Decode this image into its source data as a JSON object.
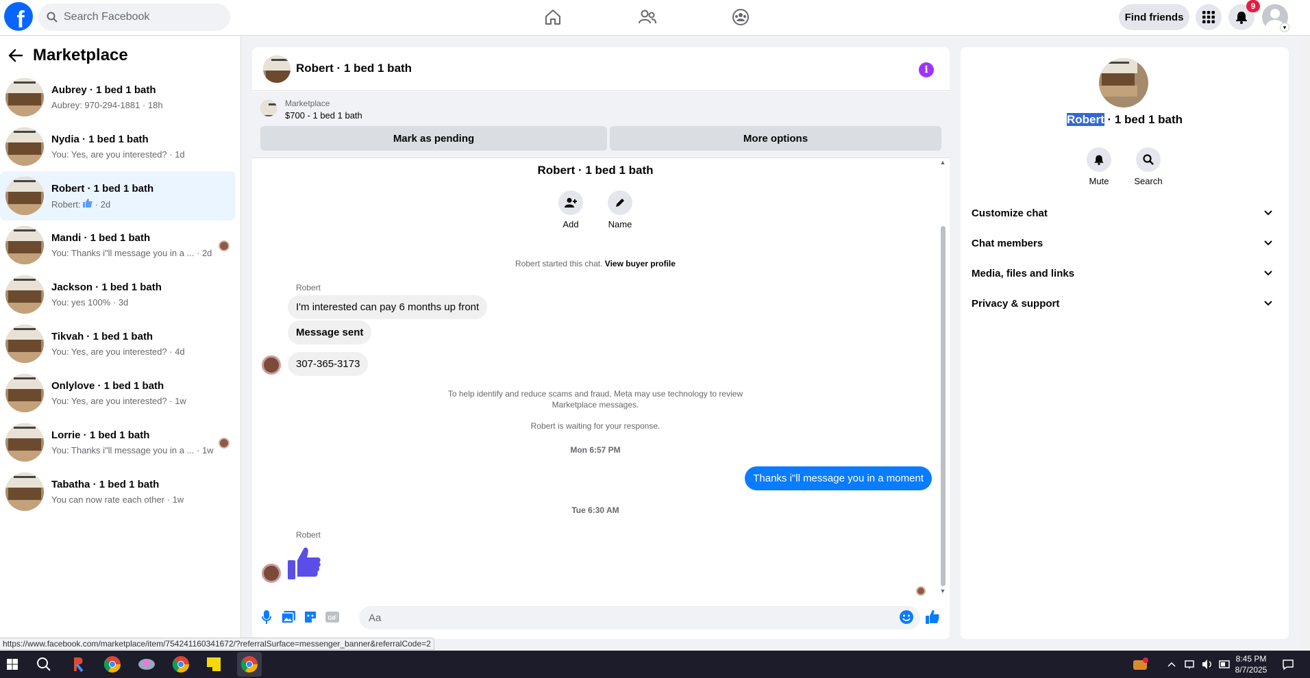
{
  "topbar": {
    "search_placeholder": "Search Facebook",
    "find_friends": "Find friends",
    "notif_count": "9"
  },
  "left": {
    "title": "Marketplace",
    "conversations": [
      {
        "name": "Aubrey · 1 bed 1 bath",
        "preview": "Aubrey: 970-294-1881 · 18h"
      },
      {
        "name": "Nydia · 1 bed 1 bath",
        "preview": "You: Yes, are you interested? · 1d"
      },
      {
        "name": "Robert · 1 bed 1 bath",
        "preview_prefix": "Robert: ",
        "preview_suffix": " · 2d"
      },
      {
        "name": "Mandi · 1 bed 1 bath",
        "preview": "You: Thanks i\"ll message you in a ... · 2d"
      },
      {
        "name": "Jackson · 1 bed 1 bath",
        "preview": "You: yes 100% · 3d"
      },
      {
        "name": "Tikvah · 1 bed 1 bath",
        "preview": "You: Yes, are you interested? · 4d"
      },
      {
        "name": "Onlylove · 1 bed 1 bath",
        "preview": "You: Yes, are you interested? · 1w"
      },
      {
        "name": "Lorrie · 1 bed 1 bath",
        "preview": "You: Thanks i\"ll message you in a ... · 1w"
      },
      {
        "name": "Tabatha · 1 bed 1 bath",
        "preview": "You can now rate each other · 1w"
      }
    ]
  },
  "chat": {
    "title": "Robert · 1 bed 1 bath",
    "banner": {
      "label": "Marketplace",
      "listing": "$700 - 1 bed 1 bath",
      "mark_pending": "Mark as pending",
      "more_options": "More options"
    },
    "intro_name": "Robert · 1 bed 1 bath",
    "add_label": "Add",
    "name_label": "Name",
    "started_text": "Robert started this chat.",
    "view_buyer": "View buyer profile",
    "sender1": "Robert",
    "msg1": "I'm interested can pay 6 months up front",
    "msg2": "Message sent",
    "msg3": "307-365-3173",
    "scam_notice_1": "To help identify and reduce scams and fraud, Meta may use technology to review",
    "scam_notice_2": "Marketplace messages.",
    "waiting": "Robert is waiting for your response.",
    "ts1": "Mon 6:57 PM",
    "out_msg": "Thanks i\"ll message you in a moment",
    "ts2": "Tue 6:30 AM",
    "sender2": "Robert",
    "input_placeholder": "Aa"
  },
  "right": {
    "name_highlight": "Robert",
    "name_rest": " · 1 bed 1 bath",
    "mute": "Mute",
    "search": "Search",
    "sections": [
      "Customize chat",
      "Chat members",
      "Media, files and links",
      "Privacy & support"
    ]
  },
  "status_url": "https://www.facebook.com/marketplace/item/754241160341672/?referralSurface=messenger_banner&referralCode=2",
  "taskbar": {
    "time": "8:45 PM",
    "date": "8/7/2025"
  },
  "colors": {
    "brand": "#0866ff",
    "messenger_blue": "#0a7cff",
    "like_purple": "#5b4de8",
    "info": "#a033ff"
  }
}
